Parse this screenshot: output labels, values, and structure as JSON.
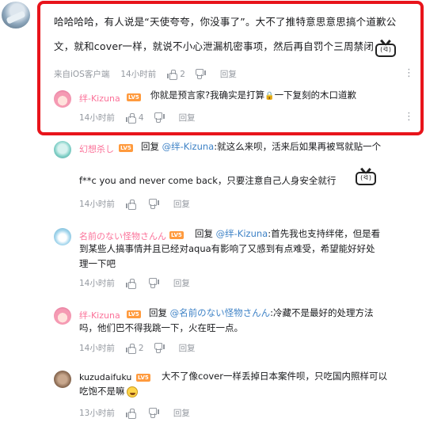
{
  "main_comment": {
    "line1": "哈哈哈哈，有人说是“天使夸夸，你没事了”。大不了推特意思意思搞个道歉公",
    "line2": "文，就和cover一样，就说不小心泄漏机密事项，然后再自罚个三周禁闭",
    "source": "来自iOS客户端",
    "time": "14小时前",
    "likes": "2",
    "reply_label": "回复",
    "emoticon": "(ᐛ)"
  },
  "replies": [
    {
      "user": "绊-Kizuna",
      "level": "LV5",
      "text_before": "你就是预言家?我确实是打算",
      "lock": "🔒",
      "text_after": "一下复刻的木口道歉",
      "time": "14小时前",
      "likes": "4",
      "reply_label": "回复"
    },
    {
      "user": "幻想杀し",
      "level": "LV5",
      "reply_prefix": "回复",
      "mention": "@绊-Kizuna",
      "line1": ":就这么来呗，活来后如果再被骂就贴一个",
      "line2": "f**c you and never come back，只要注意自己人身安全就行",
      "emoticon": "(ᐛ)",
      "time": "14小时前",
      "reply_label": "回复"
    },
    {
      "user": "名前のない怪物さんん",
      "level": "LV5",
      "reply_prefix": "回复",
      "mention": "@绊-Kizuna",
      "line1": ":首先我也支持绊佬，但是看",
      "line2": "到某些人搞事情并且已经对aqua有影响了又感到有点难受，希望能好好处",
      "line3": "理一下吧",
      "time": "14小时前",
      "reply_label": "回复"
    },
    {
      "user": "绊-Kizuna",
      "level": "LV5",
      "reply_prefix": "回复",
      "mention": "@名前のない怪物さんん",
      "line1": ":冷藏不是最好的处理方法",
      "line2": "吗，他们巴不得我跳一下，火在旺一点。",
      "time": "14小时前",
      "likes": "2",
      "reply_label": "回复"
    },
    {
      "user": "kuzudaifuku",
      "level": "LV5",
      "line1": "大不了像cover一样丢掉日本案件呗，只吃国内照样可以",
      "line2": "吃饱不是嘛",
      "time": "13小时前",
      "reply_label": "回复"
    }
  ],
  "colors": {
    "highlight_border": "#e8141b",
    "username_pink": "#fb7299",
    "mention_blue": "#3e82c6",
    "meta_gray": "#9499a0",
    "level_badge": "#ff9a3d"
  }
}
